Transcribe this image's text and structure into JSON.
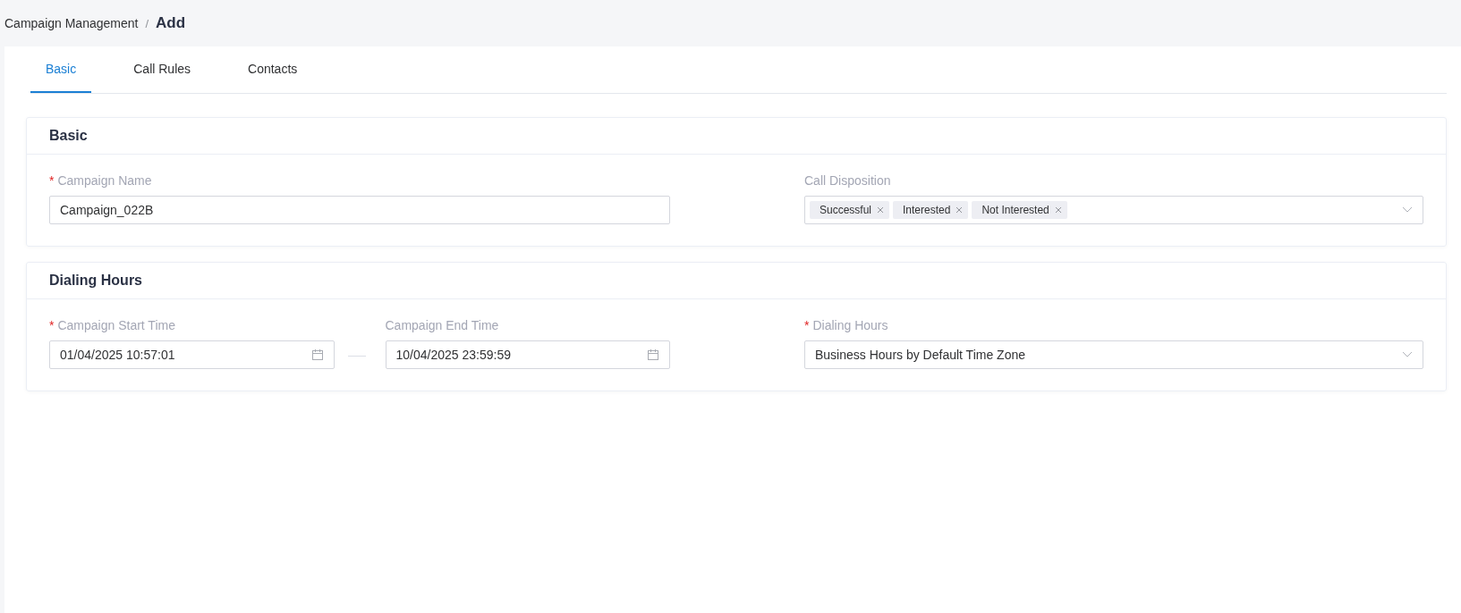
{
  "breadcrumb": {
    "parent": "Campaign Management",
    "separator": "/",
    "current": "Add"
  },
  "tabs": [
    {
      "label": "Basic",
      "selected": true
    },
    {
      "label": "Call Rules",
      "selected": false
    },
    {
      "label": "Contacts",
      "selected": false
    }
  ],
  "sections": [
    {
      "title": "Basic",
      "fields": [
        {
          "kind": "text",
          "label": "Campaign Name",
          "required_mark": "*",
          "value": "Campaign_022B"
        },
        {
          "kind": "tags",
          "label": "Call Disposition",
          "tags": [
            "Successful",
            "Interested",
            "Not Interested"
          ]
        }
      ]
    },
    {
      "title": "Dialing Hours",
      "fields": [
        {
          "kind": "range",
          "start": {
            "label": "Campaign Start Time",
            "required_mark": "*",
            "value": "01/04/2025 10:57:01"
          },
          "end": {
            "label": "Campaign End Time",
            "value": "10/04/2025 23:59:59"
          }
        },
        {
          "kind": "select",
          "label": "Dialing Hours",
          "required_mark": "*",
          "value": "Business Hours by Default Time Zone"
        }
      ]
    }
  ]
}
